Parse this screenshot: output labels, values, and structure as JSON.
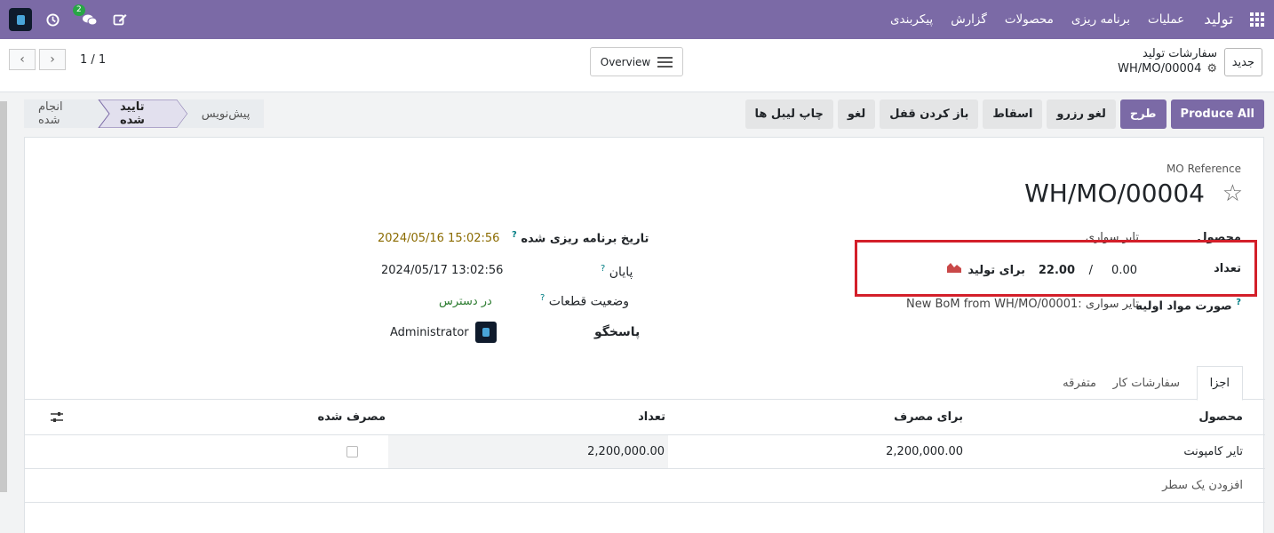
{
  "navbar": {
    "brand": "تولید",
    "menu": [
      "عملیات",
      "برنامه ریزی",
      "محصولات",
      "گزارش",
      "پیکربندی"
    ],
    "chat_badge": "2"
  },
  "control": {
    "new_label": "جدید",
    "breadcrumb_parent": "سفارشات تولید",
    "breadcrumb_current": "WH/MO/00004",
    "overview_label": "Overview",
    "pager": "1 / 1"
  },
  "actions": [
    "Produce All",
    "طرح",
    "لغو رزرو",
    "اسقاط",
    "باز کردن قفل",
    "لغو",
    "چاپ لیبل ها"
  ],
  "stages": [
    "انجام شده",
    "تایید شده",
    "پیش‌نویس"
  ],
  "form": {
    "mo_label": "MO Reference",
    "mo_name": "WH/MO/00004",
    "product_label": "محصول",
    "product_value": "تایر سواری",
    "qty_label": "تعداد",
    "qty_produced": "0.00",
    "qty_sep": "/",
    "qty_total": "22.00",
    "qty_unit_label": "برای تولید",
    "bom_label": "صورت مواد اولیه",
    "bom_value": "New BoM from WH/MO/00001: تایر سواری",
    "date_planned_label": "تاریخ برنامه ریزی شده",
    "date_planned": "2024/05/16 15:02:56",
    "date_end_label": "پایان",
    "date_end": "2024/05/17 13:02:56",
    "components_label": "وضعیت قطعات",
    "components_value": "در دسترس",
    "responsible_label": "پاسخگو",
    "responsible_value": "Administrator"
  },
  "tabs": [
    "اجزا",
    "سفارشات کار",
    "متفرقه"
  ],
  "table": {
    "headers": [
      "محصول",
      "برای مصرف",
      "تعداد",
      "مصرف شده"
    ],
    "rows": [
      {
        "product": "تایر کامپونت",
        "to_consume": "2,200,000.00",
        "quantity": "2,200,000.00"
      }
    ],
    "add_line": "افزودن یک سطر"
  }
}
